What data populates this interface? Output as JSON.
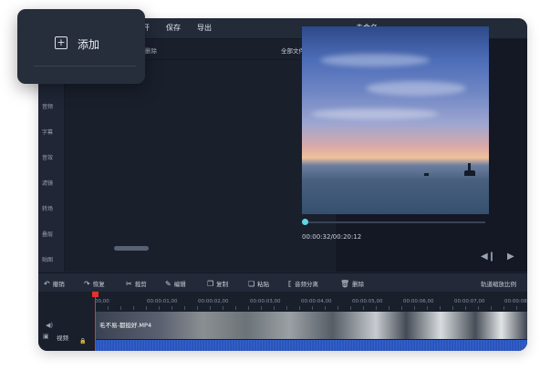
{
  "menu": {
    "items": [
      "开",
      "保存",
      "导出"
    ],
    "title": "未命名"
  },
  "sidebar": {
    "items": [
      "音频",
      "字幕",
      "音效",
      "滤镜",
      "转场",
      "叠层",
      "贴图"
    ]
  },
  "media": {
    "delete_label": "删除",
    "filter_label": "全部文件",
    "filter_caret": "▾"
  },
  "preview": {
    "time": "00:00:32/00:20:12",
    "prev_icon": "◀❙",
    "play_icon": "▶"
  },
  "toolbar": {
    "items": [
      {
        "icon": "undo-icon",
        "glyph": "↶",
        "label": "撤销"
      },
      {
        "icon": "redo-icon",
        "glyph": "↷",
        "label": "恢复"
      },
      {
        "icon": "scissors-icon",
        "glyph": "✂",
        "label": "裁剪"
      },
      {
        "icon": "pencil-icon",
        "glyph": "✎",
        "label": "编辑"
      },
      {
        "icon": "copy-icon",
        "glyph": "❐",
        "label": "复制"
      },
      {
        "icon": "paste-icon",
        "glyph": "❏",
        "label": "粘贴"
      },
      {
        "icon": "split-audio-icon",
        "glyph": "⟦",
        "label": "音频分离"
      },
      {
        "icon": "trash-icon",
        "glyph": "🗑",
        "label": "删除"
      }
    ],
    "zoom_label": "轨道缩放比例"
  },
  "timeline": {
    "ruler": [
      "00,00",
      "00:00:01,00",
      "00:00:02,00",
      "00:00:03,00",
      "00:00:04,00",
      "00:00:05,00",
      "00:00:06,00",
      "00:00:07,00",
      "00:00:08"
    ],
    "track_label": "视频",
    "clip_name": "毛不易-都挺好.MP4"
  },
  "popup": {
    "icon": "+",
    "label": "添加"
  },
  "colors": {
    "accent": "#5fd6e6",
    "playhead": "#e0332e",
    "window_bg": "#1d2230"
  }
}
